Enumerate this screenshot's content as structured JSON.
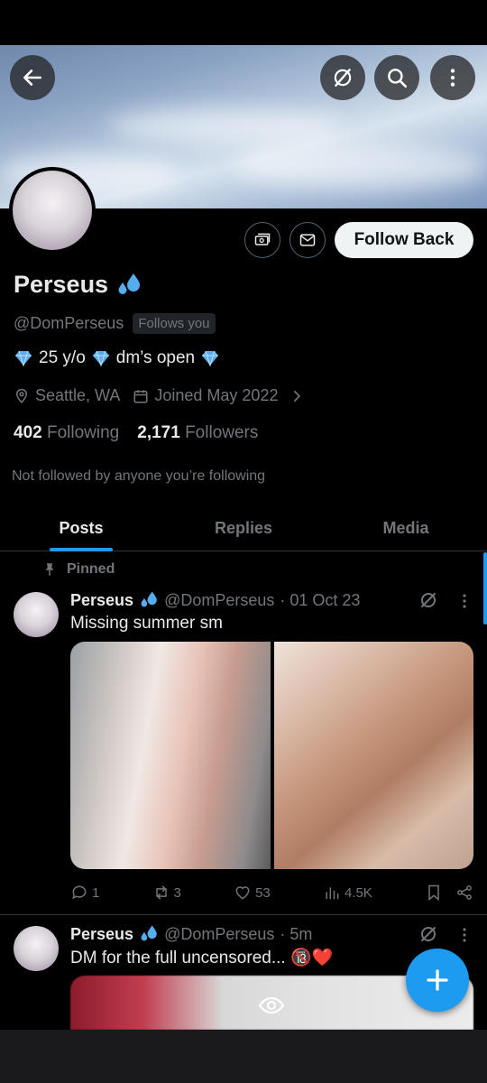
{
  "profile": {
    "name": "Perseus",
    "handle": "@DomPerseus",
    "follows_you": "Follows you",
    "bio": {
      "age": "25 y/o",
      "dms": "dm’s open"
    },
    "location": "Seattle, WA",
    "joined": "Joined May 2022",
    "following_count": "402",
    "following_label": "Following",
    "followers_count": "2,171",
    "followers_label": "Followers",
    "not_followed_text": "Not followed by anyone you’re following",
    "follow_back_label": "Follow Back"
  },
  "header_icons": [
    "back-arrow-icon",
    "grok-icon",
    "search-icon",
    "more-vertical-icon"
  ],
  "tabs": [
    {
      "label": "Posts"
    },
    {
      "label": "Replies"
    },
    {
      "label": "Media"
    }
  ],
  "pinned_label": "Pinned",
  "posts": [
    {
      "name": "Perseus",
      "handle": "@DomPerseus",
      "time": "· 01 Oct 23",
      "text": "Missing summer sm",
      "replies": "1",
      "reposts": "3",
      "likes": "53",
      "views": "4.5K"
    },
    {
      "name": "Perseus",
      "handle": "@DomPerseus",
      "time": "· 5m",
      "text": "DM for the full uncensored... 🔞❤️"
    }
  ],
  "colors": {
    "accent": "#1d9bf0",
    "background": "#000000",
    "secondary_text": "#71767b",
    "primary_text": "#e7e9ea"
  }
}
